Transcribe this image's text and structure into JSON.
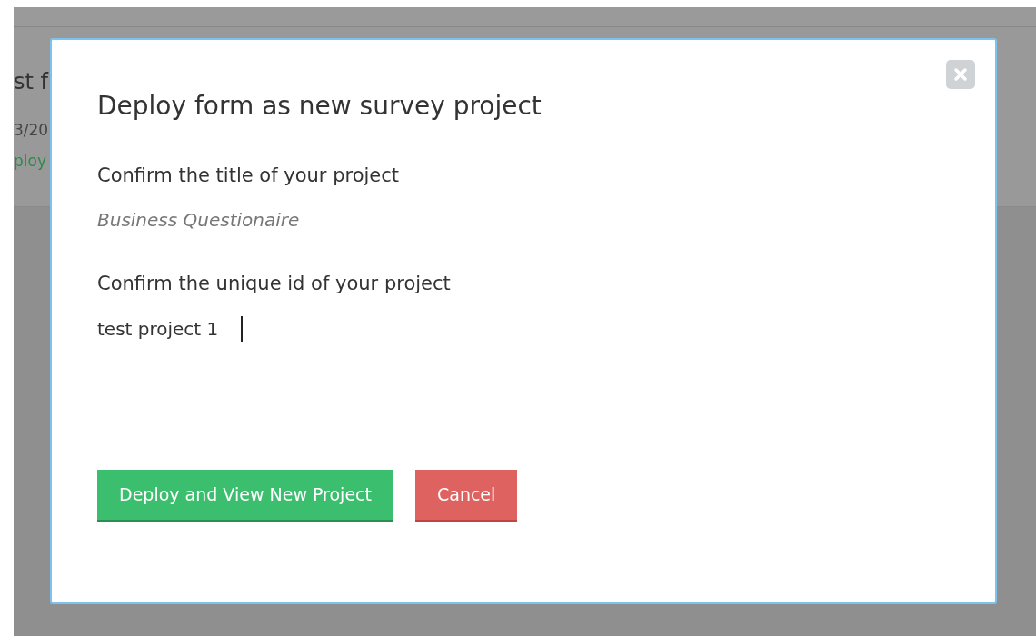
{
  "background_list": {
    "item": {
      "title": "st f",
      "date": "3/20",
      "action": "ploy"
    }
  },
  "modal": {
    "title": "Deploy form as new survey project",
    "title_label": "Confirm the title of your project",
    "title_value": "Business Questionaire",
    "id_label": "Confirm the unique id of your project",
    "id_value": "test project 1",
    "buttons": [
      {
        "label": "Deploy and View New Project",
        "kind": "primary"
      },
      {
        "label": "Cancel",
        "kind": "danger"
      }
    ]
  }
}
